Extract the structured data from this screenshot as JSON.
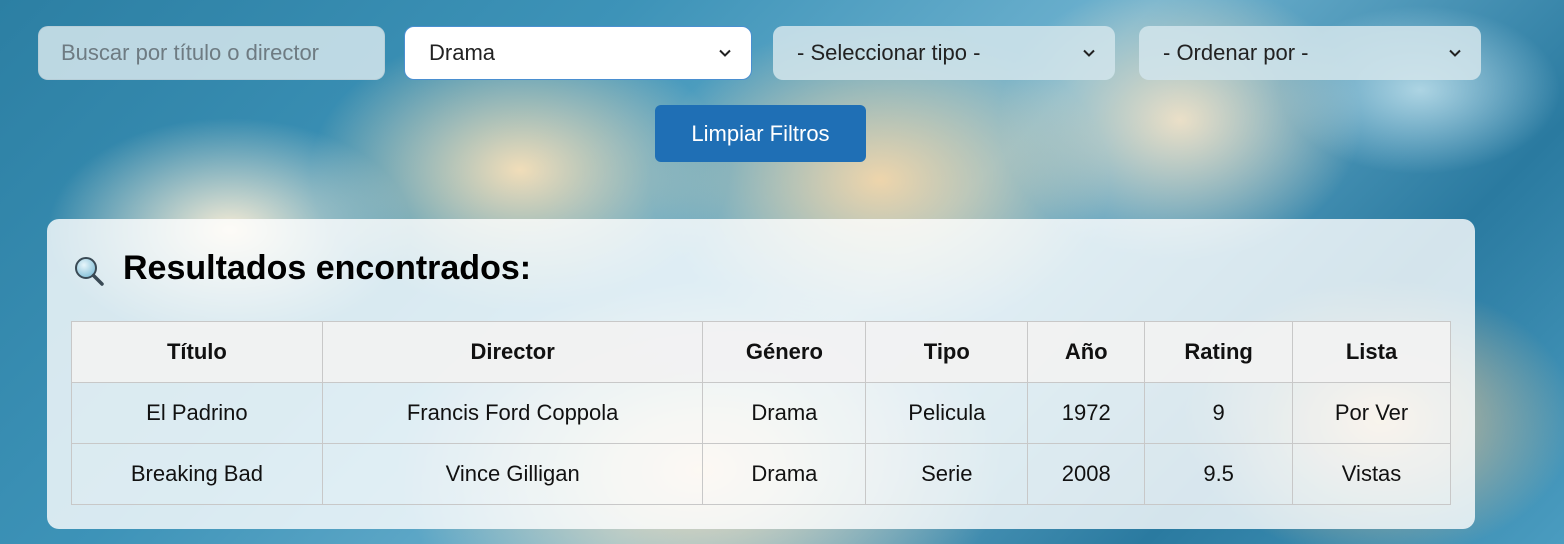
{
  "filters": {
    "search_placeholder": "Buscar por título o director",
    "genre_selected": "Drama",
    "type_selected": "- Seleccionar tipo -",
    "order_selected": "- Ordenar por -",
    "clear_label": "Limpiar Filtros"
  },
  "results": {
    "title": "Resultados encontrados:",
    "columns": [
      "Título",
      "Director",
      "Género",
      "Tipo",
      "Año",
      "Rating",
      "Lista"
    ],
    "rows": [
      [
        "El Padrino",
        "Francis Ford Coppola",
        "Drama",
        "Pelicula",
        "1972",
        "9",
        "Por Ver"
      ],
      [
        "Breaking Bad",
        "Vince Gilligan",
        "Drama",
        "Serie",
        "2008",
        "9.5",
        "Vistas"
      ]
    ]
  },
  "colors": {
    "primary_button": "#1f6fb5",
    "focus_border": "#4a8fd0"
  }
}
